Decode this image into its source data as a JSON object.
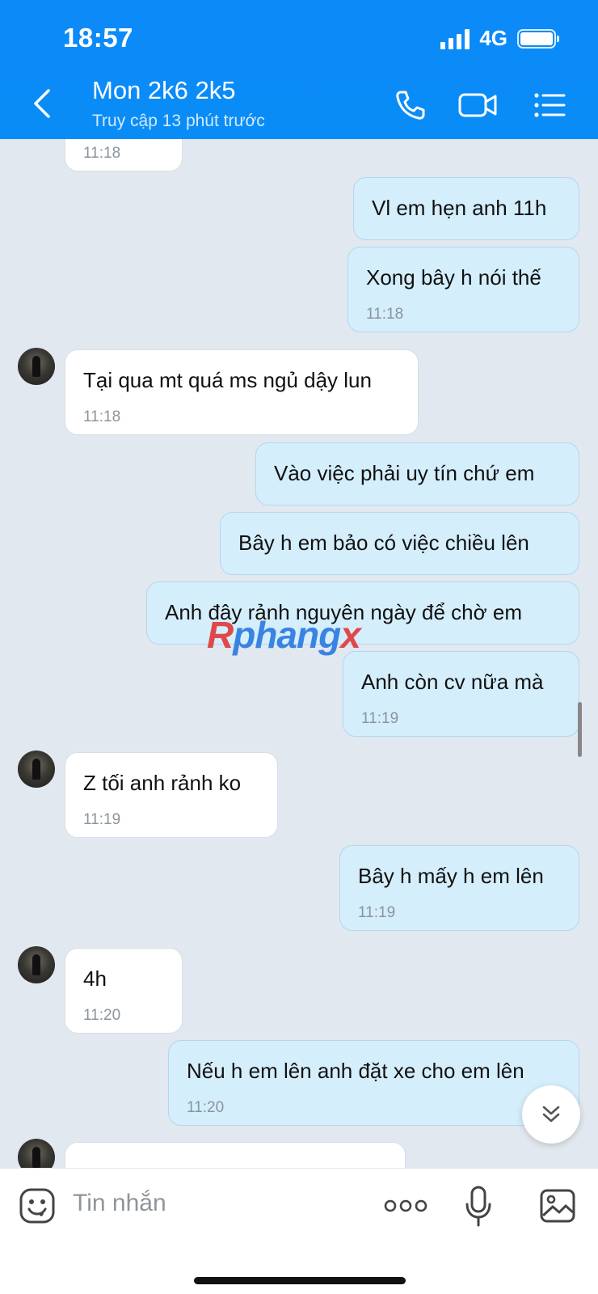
{
  "status_bar": {
    "time": "18:57",
    "network": "4G"
  },
  "header": {
    "title": "Mon 2k6 2k5",
    "subtitle": "Truy cập 13 phút trước"
  },
  "icons": {
    "back": "chevron-left-icon",
    "call": "phone-icon",
    "video": "video-call-icon",
    "menu": "list-menu-icon",
    "sticker": "emoji-icon",
    "more": "more-dots-icon",
    "mic": "microphone-icon",
    "image": "image-icon",
    "scroll": "double-chevron-down-icon"
  },
  "messages": [
    {
      "side": "in",
      "text": "",
      "time": "11:18"
    },
    {
      "side": "out",
      "text": "Vl em hẹn anh 11h",
      "time": ""
    },
    {
      "side": "out",
      "text": "Xong bây h nói thế",
      "time": "11:18"
    },
    {
      "side": "in",
      "text": "Tại qua mt quá ms ngủ dậy lun",
      "time": "11:18"
    },
    {
      "side": "out",
      "text": "Vào việc phải uy tín chứ em",
      "time": ""
    },
    {
      "side": "out",
      "text": "Bây h em bảo có việc chiều lên",
      "time": ""
    },
    {
      "side": "out",
      "text": "Anh đây rảnh nguyên ngày để chờ em",
      "time": ""
    },
    {
      "side": "out",
      "text": "Anh còn cv nữa mà",
      "time": "11:19"
    },
    {
      "side": "in",
      "text": "Z tối anh rảnh ko",
      "time": "11:19"
    },
    {
      "side": "out",
      "text": "Bây h mấy h em lên",
      "time": "11:19"
    },
    {
      "side": "in",
      "text": "4h",
      "time": "11:20"
    },
    {
      "side": "out",
      "text": "Nếu h em lên anh đặt xe cho em lên",
      "time": "11:20"
    }
  ],
  "watermark": {
    "part1": "R",
    "part2": "phang",
    "part3": "x"
  },
  "composer": {
    "placeholder": "Tin nhắn"
  },
  "colors": {
    "header": "#0a8cf7",
    "outgoing": "#d5eefc",
    "incoming": "#ffffff",
    "background": "#e2e8ef"
  }
}
